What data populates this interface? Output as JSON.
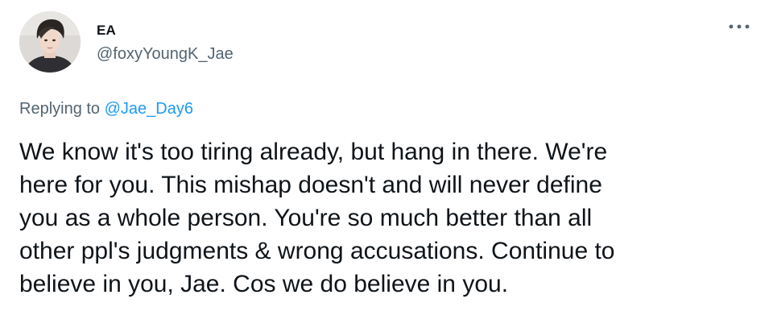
{
  "author": {
    "display_name": "EA",
    "handle": "@foxyYoungK_Jae"
  },
  "reply": {
    "prefix": "Replying to",
    "mention": "@Jae_Day6"
  },
  "tweet": {
    "lines": [
      "We know it's too tiring already, but hang in there. We're",
      "here for you. This mishap doesn't and will never define",
      "you as a whole person. You're so much better than all",
      "other ppl's judgments & wrong accusations. Continue to",
      "believe in you, Jae. Cos we do believe in you."
    ]
  },
  "icons": {
    "more": "more-horizontal-icon",
    "avatar": "profile-photo"
  },
  "colors": {
    "text_primary": "#0f1419",
    "text_secondary": "#536471",
    "link": "#1d9bf0",
    "background": "#ffffff"
  }
}
